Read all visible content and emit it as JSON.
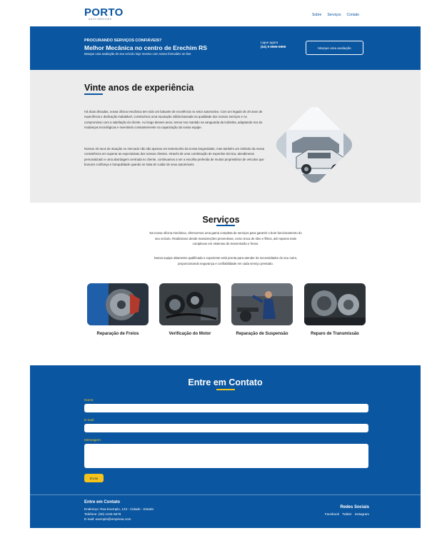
{
  "header": {
    "logo_main": "PORTO",
    "logo_sub": "AUTO SERVICES",
    "nav": [
      "Sobre",
      "Serviços",
      "Contato"
    ]
  },
  "banner": {
    "kicker": "PROCURANDO SERVIÇOS CONFIÁVEIS?",
    "title": "Melhor Mecânica no centro de Erechim RS",
    "subtitle": "Marque uma avaliação do seu veículo hoje mesmo com nosso formulário on-line",
    "call_label": "Ligue agora",
    "phone": "(54) 9 9999-9999",
    "cta": "Marque uma avaliação"
  },
  "experience": {
    "title": "Vinte anos de experiência",
    "p1": "Há duas décadas, nossa oficina mecânica tem sido um baluarte de excelência no setor automotivo. Com um legado de 20 anos de experiência e dedicação inabalável, construímos uma reputação sólida baseada na qualidade dos nossos serviços e no compromisso com a satisfação do cliente. Ao longo desses anos, temos nos mantido na vanguarda da indústria, adaptando-nos às mudanças tecnológicas e investindo constantemente na capacitação da nossa equipe.",
    "p2": "Nossos 20 anos de atuação no mercado não são apenas um testemunho da nossa longevidade, mas também um símbolo da nossa consistência em superar as expectativas dos nossos clientes. Através de uma combinação de expertise técnica, atendimento personalizado e uma abordagem centrada no cliente, continuamos a ser a escolha preferida de muitos proprietários de veículos que buscam confiança e tranquilidade quando se trata de cuidar de seus automóveis."
  },
  "services": {
    "title": "Serviços",
    "p1": "Na nossa oficina mecânica, oferecemos uma gama completa de serviços para garantir o bom funcionamento do seu veículo. Realizamos desde manutenções preventivas, como troca de óleo e filtros, até reparos mais complexos em sistemas de transmissão e freios.",
    "p2": "Nossa equipe altamente qualificada e experiente está pronta para atender às necessidades do seu carro, proporcionando segurança e confiabilidade em cada serviço prestado.",
    "items": [
      {
        "label": "Reparação de Freios",
        "icon": "brake-disc-photo"
      },
      {
        "label": "Verificação do Motor",
        "icon": "engine-photo"
      },
      {
        "label": "Reparação de Suspensão",
        "icon": "mechanic-suspension-photo"
      },
      {
        "label": "Reparo de Transmissão",
        "icon": "gearbox-photo"
      }
    ]
  },
  "contact": {
    "title": "Entre em Contato",
    "name_label": "Nome:",
    "email_label": "E-mail:",
    "message_label": "Mensagem:",
    "submit": "Enviar"
  },
  "footer": {
    "title": "Entre em Contato",
    "address": "Endereço: Rua Exemplo, 123 - Cidade - Estado",
    "phone": "Telefone: (00) 1234-5678",
    "email": "E-mail: exemplo@empresa.com",
    "social_title": "Redes Sociais",
    "social": [
      "Facebook",
      "Twitter",
      "Instagram"
    ]
  },
  "colors": {
    "brand_blue": "#0a56a0",
    "accent_yellow": "#f4c41d",
    "section_gray": "#ececec"
  }
}
